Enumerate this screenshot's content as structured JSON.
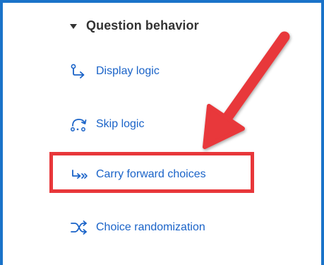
{
  "section": {
    "title": "Question behavior"
  },
  "menu": {
    "items": [
      {
        "label": "Display logic",
        "icon": "display-logic-icon"
      },
      {
        "label": "Skip logic",
        "icon": "skip-logic-icon"
      },
      {
        "label": "Carry forward choices",
        "icon": "carry-forward-icon"
      },
      {
        "label": "Choice randomization",
        "icon": "shuffle-icon"
      }
    ]
  },
  "annotation": {
    "highlighted_item": "Carry forward choices",
    "highlight_color": "#e8373a",
    "arrow_color": "#e8373a"
  },
  "colors": {
    "link": "#1a63c8",
    "frame_border": "#1a73c9",
    "header_text": "#333333"
  }
}
